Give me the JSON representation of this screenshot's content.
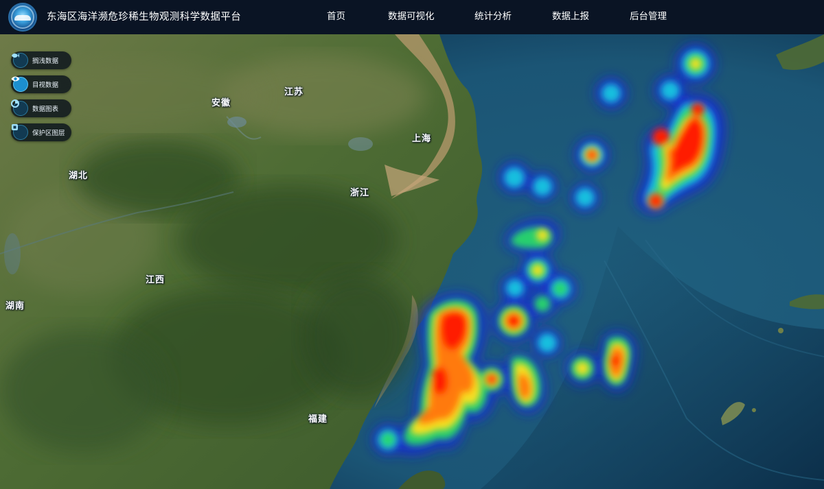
{
  "header": {
    "title": "东海区海洋濒危珍稀生物观测科学数据平台",
    "nav": [
      {
        "label": "首页"
      },
      {
        "label": "数据可视化"
      },
      {
        "label": "统计分析"
      },
      {
        "label": "数据上报"
      },
      {
        "label": "后台管理"
      }
    ]
  },
  "layers": [
    {
      "label": "搁浅数据",
      "icon": "fish-icon",
      "active": false
    },
    {
      "label": "目视数据",
      "icon": "eye-icon",
      "active": true
    },
    {
      "label": "数据图表",
      "icon": "chart-icon",
      "active": false
    },
    {
      "label": "保护区图层",
      "icon": "shield-layer-icon",
      "active": false
    }
  ],
  "provinces": [
    {
      "label": "安徽"
    },
    {
      "label": "江苏"
    },
    {
      "label": "上海"
    },
    {
      "label": "湖北"
    },
    {
      "label": "浙江"
    },
    {
      "label": "江西"
    },
    {
      "label": "湖南"
    },
    {
      "label": "福建"
    }
  ],
  "colors": {
    "header_bg": "#0a1424",
    "sea": "#1d5a78",
    "land": "#4a6a34",
    "heat_low": "#1a2bd8",
    "heat_mid": "#22d06a",
    "heat_high": "#ff1a00"
  }
}
